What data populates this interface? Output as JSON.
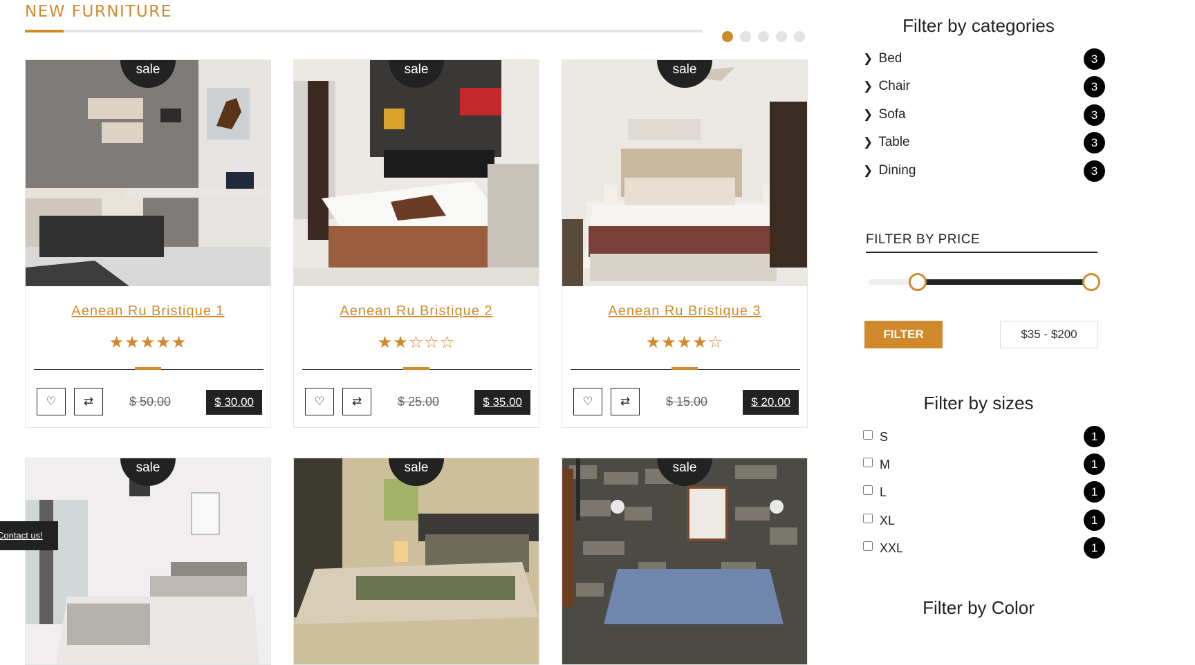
{
  "section": {
    "title": "NEW FURNITURE",
    "carousel_dots": 5,
    "active_dot": 0
  },
  "products": [
    {
      "name": "Aenean Ru Bristique 1",
      "rating": 5,
      "old_price": "$ 50.00",
      "new_price": "$ 30.00",
      "badge": "sale",
      "image": "bedroom-desk"
    },
    {
      "name": "Aenean Ru Bristique 2",
      "rating": 2,
      "old_price": "$ 25.00",
      "new_price": "$ 35.00",
      "badge": "sale",
      "image": "hotel-bed-swans"
    },
    {
      "name": "Aenean Ru Bristique 3",
      "rating": 4,
      "old_price": "$ 15.00",
      "new_price": "$ 20.00",
      "badge": "sale",
      "image": "bed-with-lamps"
    },
    {
      "badge": "sale",
      "image": "bright-bedroom"
    },
    {
      "badge": "sale",
      "image": "hotel-room-lamp"
    },
    {
      "badge": "sale",
      "image": "stone-wall-bedroom"
    }
  ],
  "contact": {
    "label": "Contact us!"
  },
  "sidebar": {
    "categories_title": "Filter by categories",
    "categories": [
      {
        "label": "Bed",
        "count": "3"
      },
      {
        "label": "Chair",
        "count": "3"
      },
      {
        "label": "Sofa",
        "count": "3"
      },
      {
        "label": "Table",
        "count": "3"
      },
      {
        "label": "Dining",
        "count": "3"
      }
    ],
    "price_title": "FILTER BY PRICE",
    "price_min_fraction": 0.22,
    "price_max_fraction": 1.0,
    "filter_button": "FILTER",
    "price_range": "$35 - $200",
    "sizes_title": "Filter by sizes",
    "sizes": [
      {
        "label": "S",
        "count": "1"
      },
      {
        "label": "M",
        "count": "1"
      },
      {
        "label": "L",
        "count": "1"
      },
      {
        "label": "XL",
        "count": "1"
      },
      {
        "label": "XXL",
        "count": "1"
      }
    ],
    "color_title": "Filter by Color"
  },
  "colors": {
    "accent": "#d08a2c",
    "dark": "#222222"
  },
  "icons": {
    "wishlist": "heart-icon",
    "compare": "compare-arrows-icon",
    "category": "chevron-right-icon"
  }
}
